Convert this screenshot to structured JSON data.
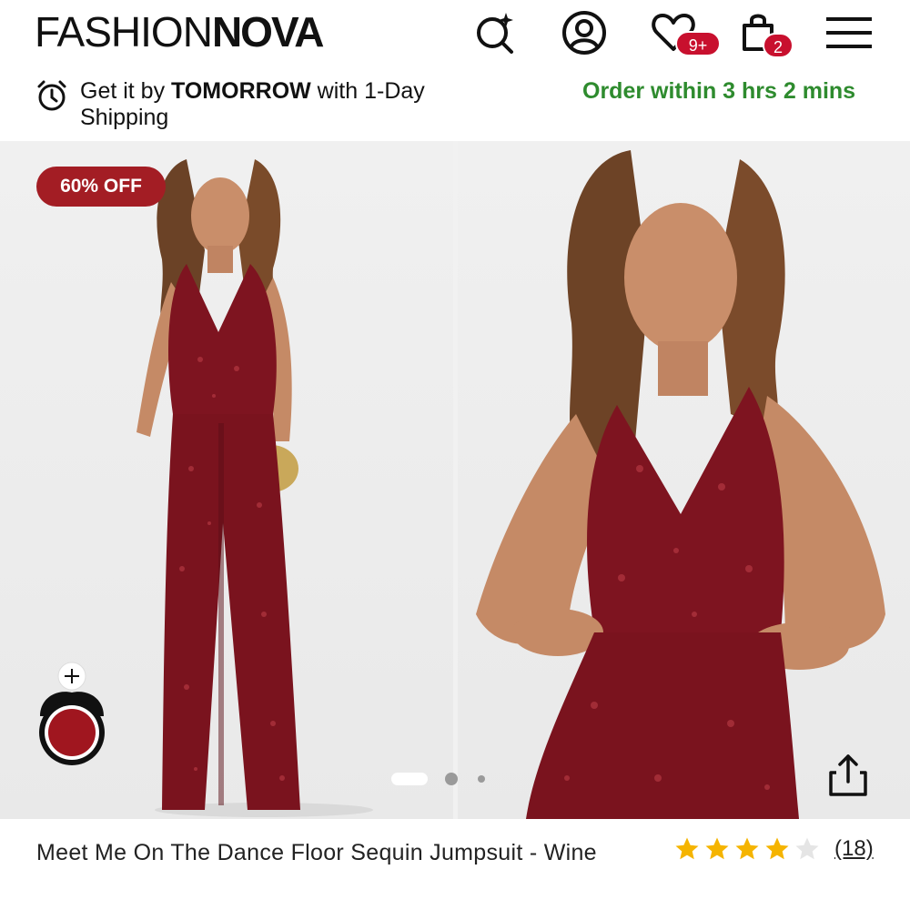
{
  "header": {
    "logo_light": "FASHION",
    "logo_bold": "NOVA",
    "icons": [
      "visual-search-icon",
      "account-icon",
      "wishlist-heart-icon",
      "cart-bag-icon",
      "hamburger-menu-icon"
    ],
    "wishlist_count": "9+",
    "cart_count": "2"
  },
  "shipping": {
    "prefix": "Get it by ",
    "highlight": "TOMORROW",
    "suffix": " with 1-Day Shipping",
    "countdown": "Order within 3 hrs 2 mins"
  },
  "gallery": {
    "discount_badge": "60% OFF",
    "add_symbol": "+",
    "swatch_color": "#a0161f",
    "current_slide": 1,
    "total_slides": 3
  },
  "product": {
    "title": "Meet Me On The Dance Floor Sequin Jumpsuit - Wine",
    "rating": 4,
    "max_rating": 5,
    "review_count": "(18)"
  },
  "colors": {
    "brand_red": "#c8102e",
    "badge_red": "#a31d24",
    "green": "#2e8b2e",
    "star_gold": "#f5b400",
    "star_empty": "#e5e5e5",
    "wine": "#7e1420"
  }
}
